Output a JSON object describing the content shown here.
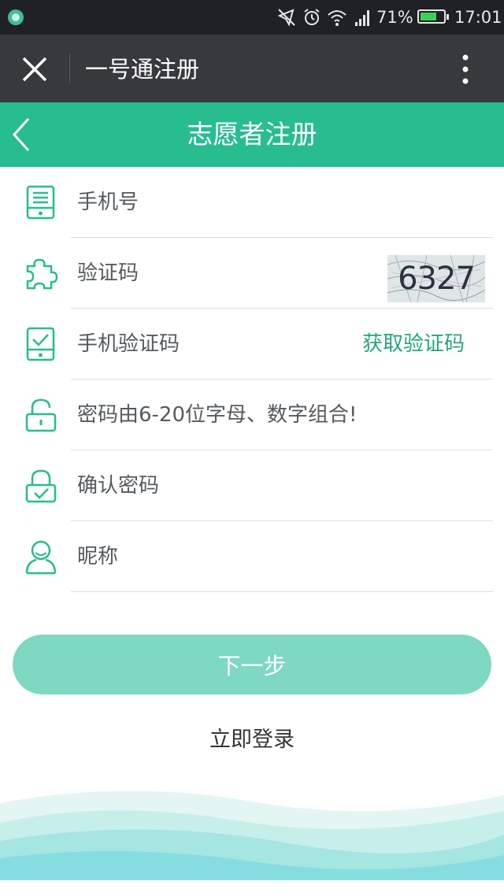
{
  "status_bar": {
    "battery_percent": "71%",
    "battery_level": 0.71,
    "time": "17:01",
    "icons": [
      "notification-app-icon",
      "mute-icon",
      "alarm-icon",
      "wifi-icon",
      "signal-icon",
      "battery-icon"
    ]
  },
  "webview": {
    "title": "一号通注册",
    "icons": [
      "close-icon",
      "more-vertical-icon"
    ]
  },
  "header": {
    "title": "志愿者注册",
    "icons": [
      "back-chevron-icon"
    ]
  },
  "form": {
    "phone_placeholder": "手机号",
    "captcha_placeholder": "验证码",
    "captcha_code": "6327",
    "sms_code_placeholder": "手机验证码",
    "get_sms_code_label": "获取验证码",
    "password_placeholder": "密码由6-20位字母、数字组合!",
    "confirm_password_placeholder": "确认密码",
    "nickname_placeholder": "昵称"
  },
  "actions": {
    "next_label": "下一步",
    "login_label": "立即登录"
  },
  "colors": {
    "accent": "#27bd8e",
    "button": "#7fd8c1",
    "link": "#27a57c",
    "status_bar": "#1f2124",
    "title_bar": "#37393c"
  }
}
